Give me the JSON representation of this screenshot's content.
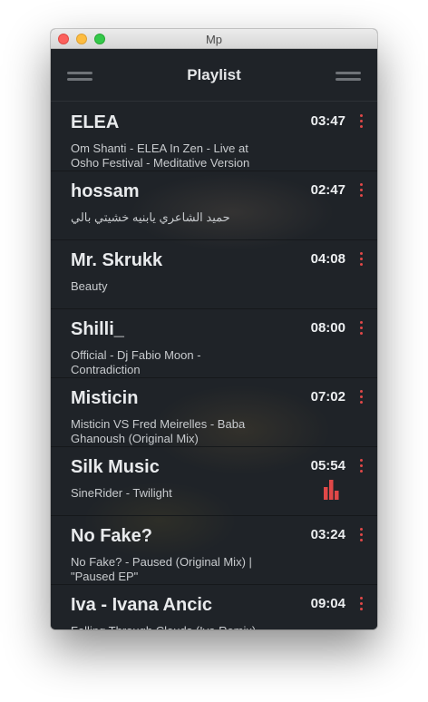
{
  "window": {
    "title": "Mp"
  },
  "header": {
    "title": "Playlist",
    "left_icon": "menu-icon",
    "right_icon": "menu-icon"
  },
  "colors": {
    "accent": "#e04848",
    "background": "#1f2328"
  },
  "playlist": [
    {
      "artist": "ELEA",
      "title": "Om Shanti - ELEA In Zen - Live at Osho Festival - Meditative Version",
      "duration": "03:47",
      "playing": false
    },
    {
      "artist": "hossam",
      "title": "حميد الشاعري يابنيه خشيتي بالي",
      "duration": "02:47",
      "playing": false
    },
    {
      "artist": "Mr. Skrukk",
      "title": "Beauty",
      "duration": "04:08",
      "playing": false
    },
    {
      "artist": "Shilli_",
      "title": "Official - Dj Fabio Moon - Contradiction",
      "duration": "08:00",
      "playing": false
    },
    {
      "artist": "Misticin",
      "title": "Misticin VS Fred Meirelles - Baba Ghanoush (Original Mix)",
      "duration": "07:02",
      "playing": false
    },
    {
      "artist": "Silk Music",
      "title": "SineRider - Twilight",
      "duration": "05:54",
      "playing": true
    },
    {
      "artist": "No Fake?",
      "title": "No Fake? - Paused (Original Mix) | \"Paused EP\"",
      "duration": "03:24",
      "playing": false
    },
    {
      "artist": "Iva - Ivana Ancic",
      "title": "Falling Through Clouds (Iva Remix)",
      "duration": "09:04",
      "playing": false
    }
  ]
}
